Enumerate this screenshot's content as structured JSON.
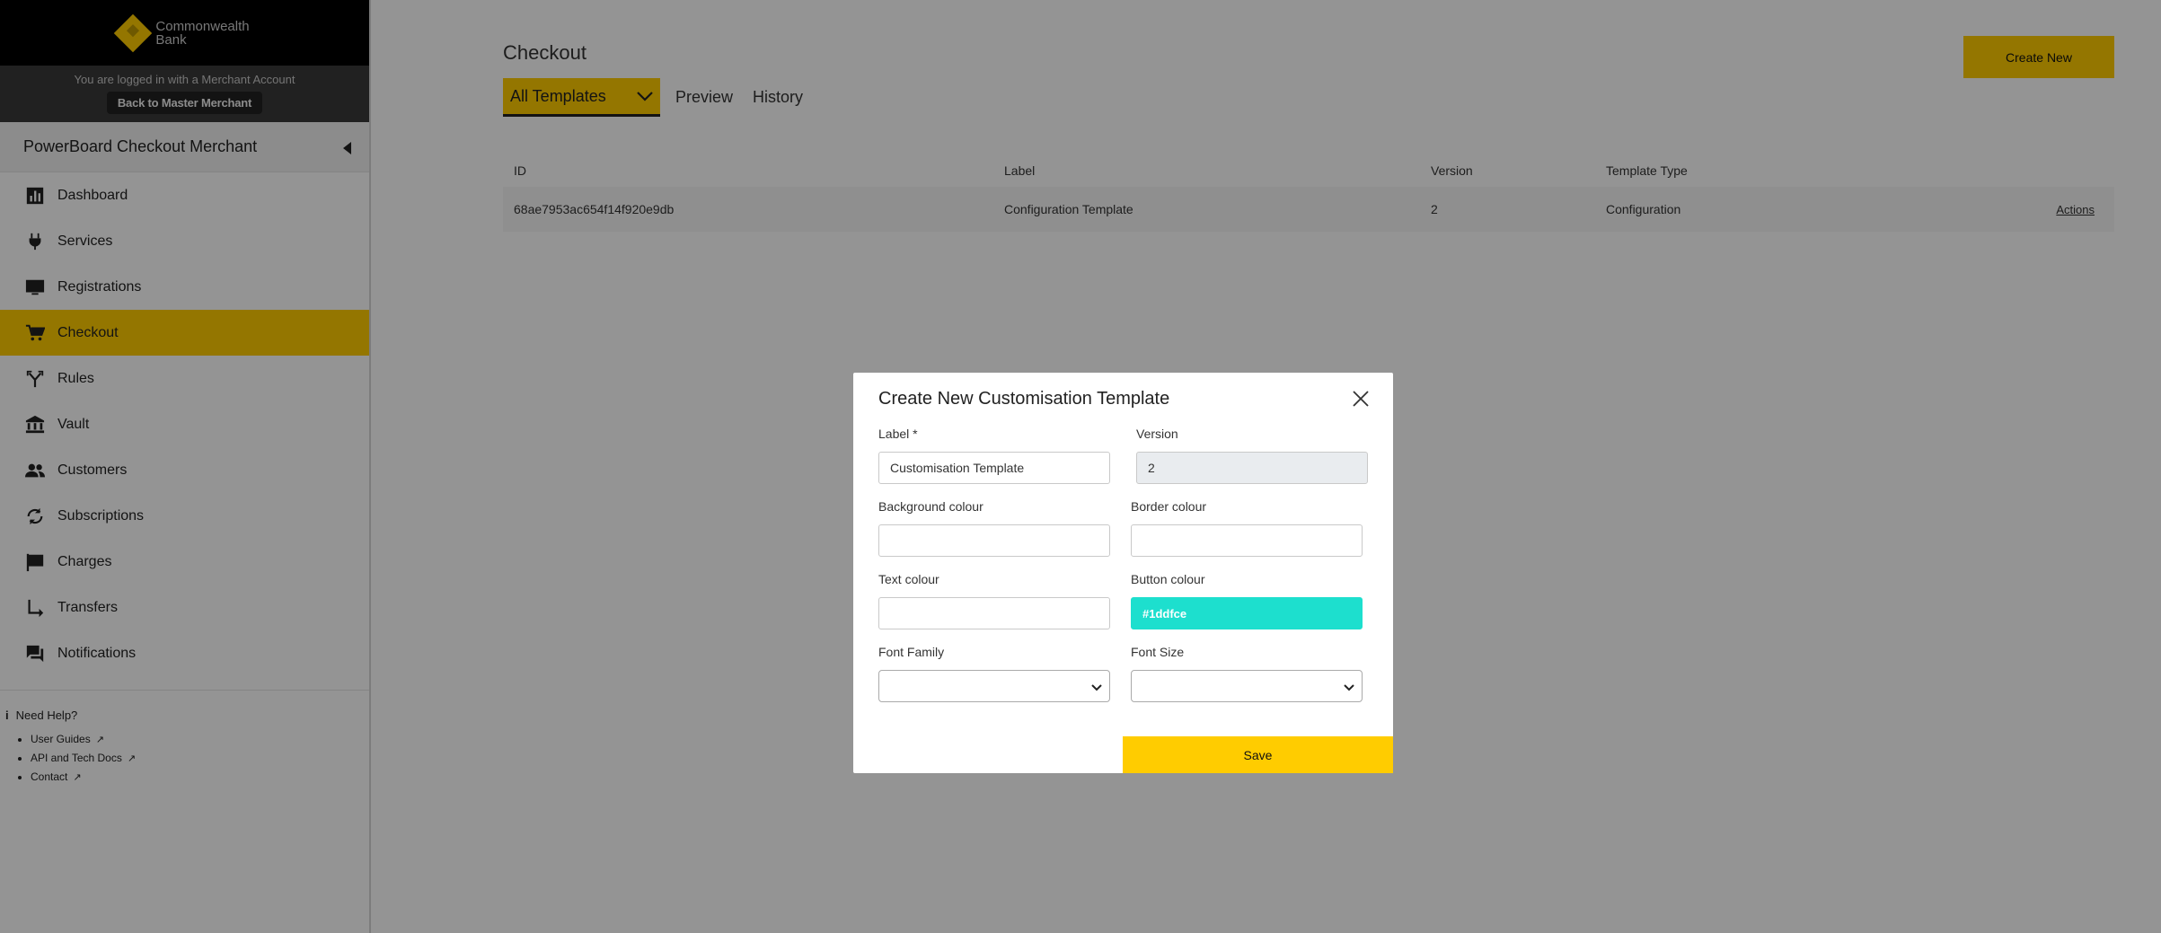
{
  "brand": {
    "line1": "Commonwealth",
    "line2": "Bank"
  },
  "login": {
    "note": "You are logged in with a Merchant Account",
    "back_label": "Back to Master Merchant"
  },
  "merchant_name": "PowerBoard Checkout Merchant",
  "nav": [
    {
      "label": "Dashboard",
      "icon": "bar-chart-icon"
    },
    {
      "label": "Services",
      "icon": "plug-icon"
    },
    {
      "label": "Registrations",
      "icon": "monitor-icon"
    },
    {
      "label": "Checkout",
      "icon": "cart-icon",
      "active": true
    },
    {
      "label": "Rules",
      "icon": "branch-icon"
    },
    {
      "label": "Vault",
      "icon": "bank-icon"
    },
    {
      "label": "Customers",
      "icon": "people-icon"
    },
    {
      "label": "Subscriptions",
      "icon": "refresh-icon"
    },
    {
      "label": "Charges",
      "icon": "flag-icon"
    },
    {
      "label": "Transfers",
      "icon": "arrow-turn-icon"
    },
    {
      "label": "Notifications",
      "icon": "chat-icon"
    }
  ],
  "help": {
    "title": "Need Help?",
    "links": [
      "User Guides",
      "API and Tech Docs",
      "Contact"
    ]
  },
  "page": {
    "title": "Checkout",
    "create_label": "Create New",
    "tabs": {
      "selected": "All Templates",
      "preview": "Preview",
      "history": "History"
    }
  },
  "table": {
    "headers": [
      "ID",
      "Label",
      "Version",
      "Template Type"
    ],
    "rows": [
      {
        "id": "68ae7953ac654f14f920e9db",
        "label": "Configuration Template",
        "version": "2",
        "type": "Configuration",
        "action": "Actions"
      }
    ]
  },
  "modal": {
    "title": "Create New Customisation Template",
    "label_label": "Label *",
    "label_value": "Customisation Template",
    "version_label": "Version",
    "version_value": "2",
    "background_label": "Background colour",
    "background_value": "",
    "border_label": "Border colour",
    "border_value": "",
    "text_label": "Text colour",
    "text_value": "",
    "button_label": "Button colour",
    "button_value": "#1ddfce",
    "font_family_label": "Font Family",
    "font_family_value": "",
    "font_size_label": "Font Size",
    "font_size_value": "",
    "save_label": "Save"
  },
  "colors": {
    "accent": "#ffcc00",
    "button_colour_swatch": "#1ddfce",
    "brand_bar": "#000000"
  }
}
